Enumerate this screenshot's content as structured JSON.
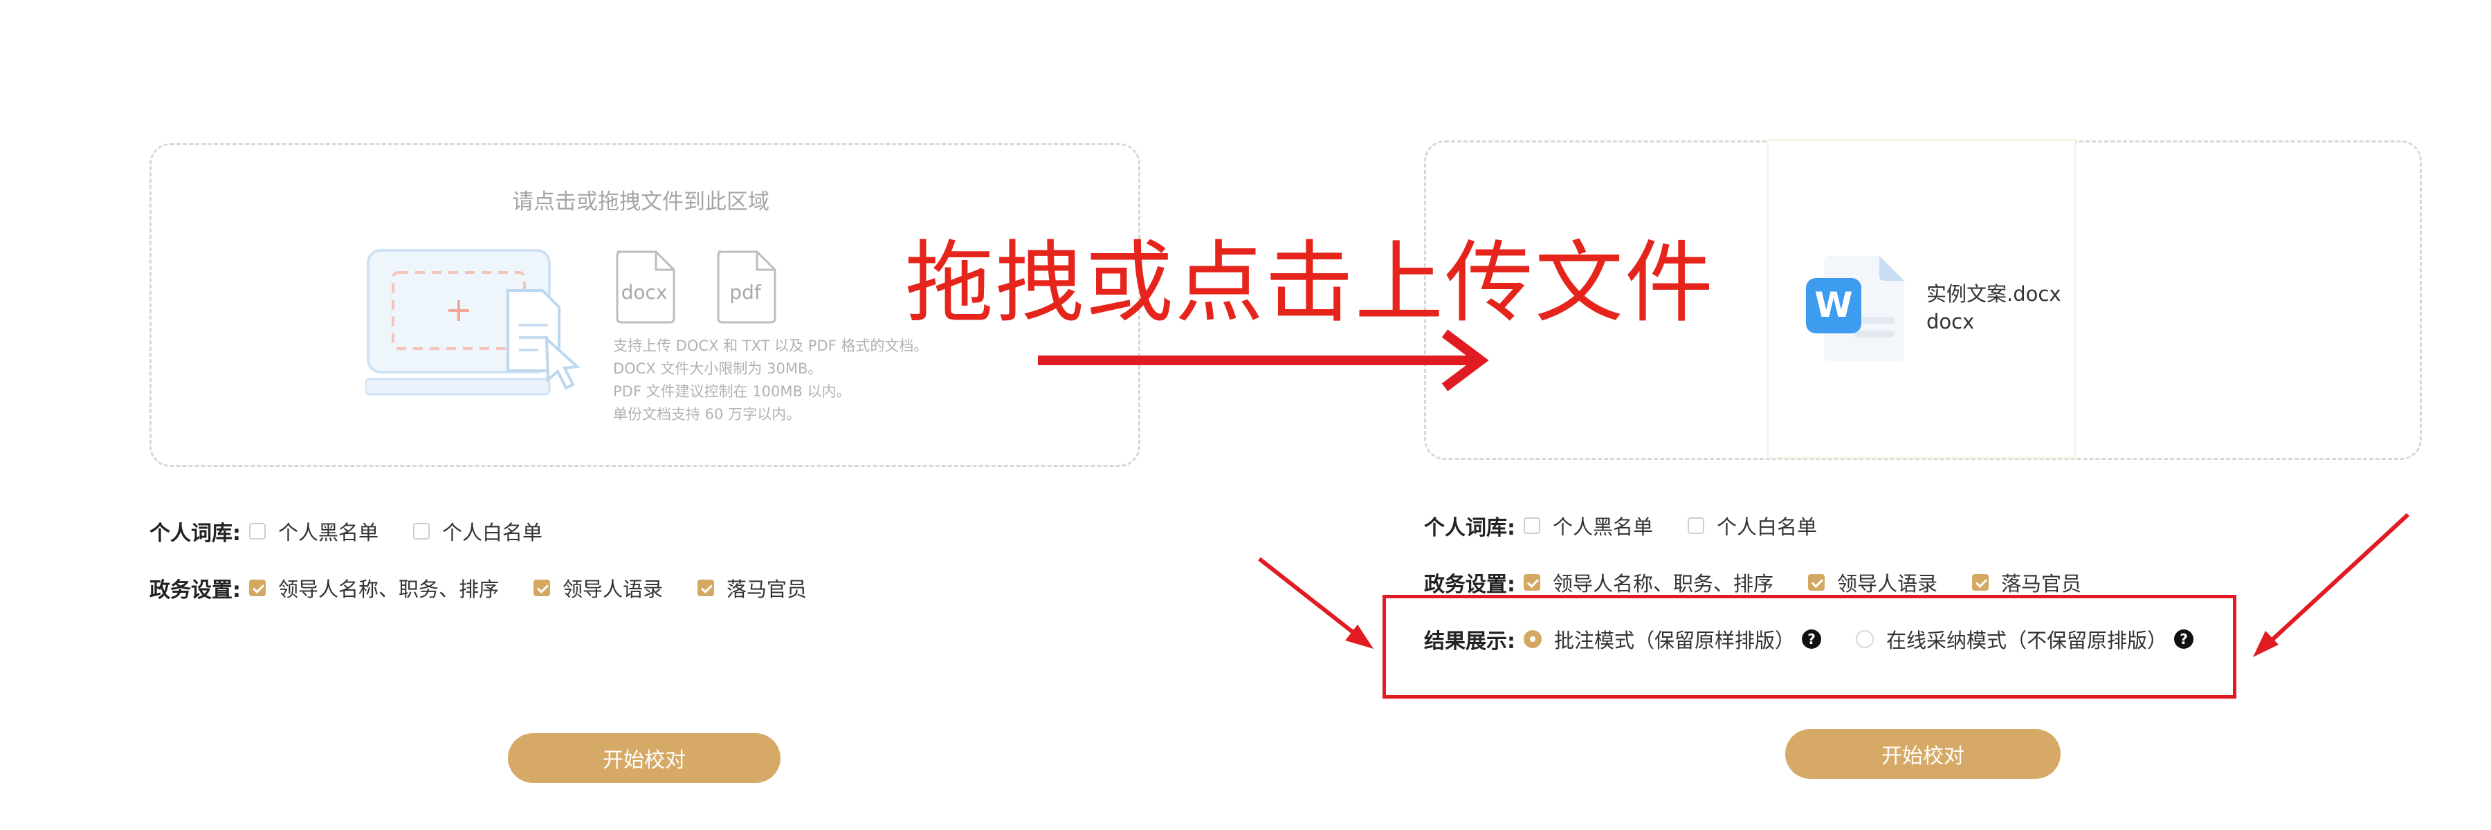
{
  "left_panel": {
    "upload_hint": "请点击或拖拽文件到此区域",
    "file_types": [
      {
        "icon": "docx-file-icon",
        "label": "docx"
      },
      {
        "icon": "pdf-file-icon",
        "label": "pdf"
      }
    ],
    "info_lines": [
      "支持上传 DOCX 和 TXT 以及 PDF 格式的文档。",
      "DOCX 文件大小限制为 30MB。",
      "PDF 文件建议控制在 100MB 以内。",
      "单份文档支持 60 万字以内。"
    ],
    "dictionary": {
      "label": "个人词库:",
      "options": [
        {
          "text": "个人黑名单",
          "checked": false
        },
        {
          "text": "个人白名单",
          "checked": false
        }
      ]
    },
    "political": {
      "label": "政务设置:",
      "options": [
        {
          "text": "领导人名称、职务、排序",
          "checked": true
        },
        {
          "text": "领导人语录",
          "checked": true
        },
        {
          "text": "落马官员",
          "checked": true
        }
      ]
    },
    "start_button": "开始校对"
  },
  "right_panel": {
    "uploaded_file": {
      "icon": "word-file-icon",
      "name": "实例文案.docx",
      "ext": "docx"
    },
    "dictionary": {
      "label": "个人词库:",
      "options": [
        {
          "text": "个人黑名单",
          "checked": false
        },
        {
          "text": "个人白名单",
          "checked": false
        }
      ]
    },
    "political": {
      "label": "政务设置:",
      "options": [
        {
          "text": "领导人名称、职务、排序",
          "checked": true
        },
        {
          "text": "领导人语录",
          "checked": true
        },
        {
          "text": "落马官员",
          "checked": true
        }
      ]
    },
    "result_display": {
      "label": "结果展示:",
      "options": [
        {
          "text": "批注模式（保留原样排版）",
          "selected": true,
          "help": "?"
        },
        {
          "text": "在线采纳模式（不保留原排版）",
          "selected": false,
          "help": "?"
        }
      ]
    },
    "start_button": "开始校对"
  },
  "annotation": {
    "title": "拖拽或点击上传文件"
  },
  "colors": {
    "accent": "#d4a862",
    "button": "#d6aa66",
    "annotation_red": "#e5241c"
  }
}
